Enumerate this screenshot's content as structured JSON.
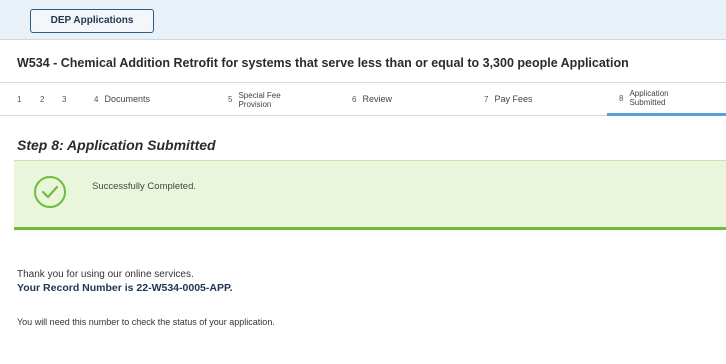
{
  "topbar": {
    "dep_button_label": "DEP Applications"
  },
  "application": {
    "title": "W534 - Chemical Addition Retrofit for systems that serve less than or equal to 3,300 people Application"
  },
  "steps": [
    {
      "num": "1",
      "label": ""
    },
    {
      "num": "2",
      "label": ""
    },
    {
      "num": "3",
      "label": ""
    },
    {
      "num": "4",
      "label": "Documents"
    },
    {
      "num": "5",
      "label_line1": "Special Fee",
      "label_line2": "Provision"
    },
    {
      "num": "6",
      "label": "Review"
    },
    {
      "num": "7",
      "label": "Pay Fees"
    },
    {
      "num": "8",
      "label_line1": "Application",
      "label_line2": "Submitted"
    }
  ],
  "main": {
    "step_heading": "Step 8: Application Submitted",
    "success_message": "Successfully Completed.",
    "thank_you": "Thank you for using our online services.",
    "record_number_text": "Your Record Number is 22-W534-0005-APP.",
    "need_number_text": "You will need this number to check the status of your application."
  },
  "colors": {
    "accent_blue": "#5aa0d8",
    "success_green": "#6dbd3d",
    "success_bg": "#eaf6dc",
    "topbar_bg": "#e8f1f8"
  }
}
